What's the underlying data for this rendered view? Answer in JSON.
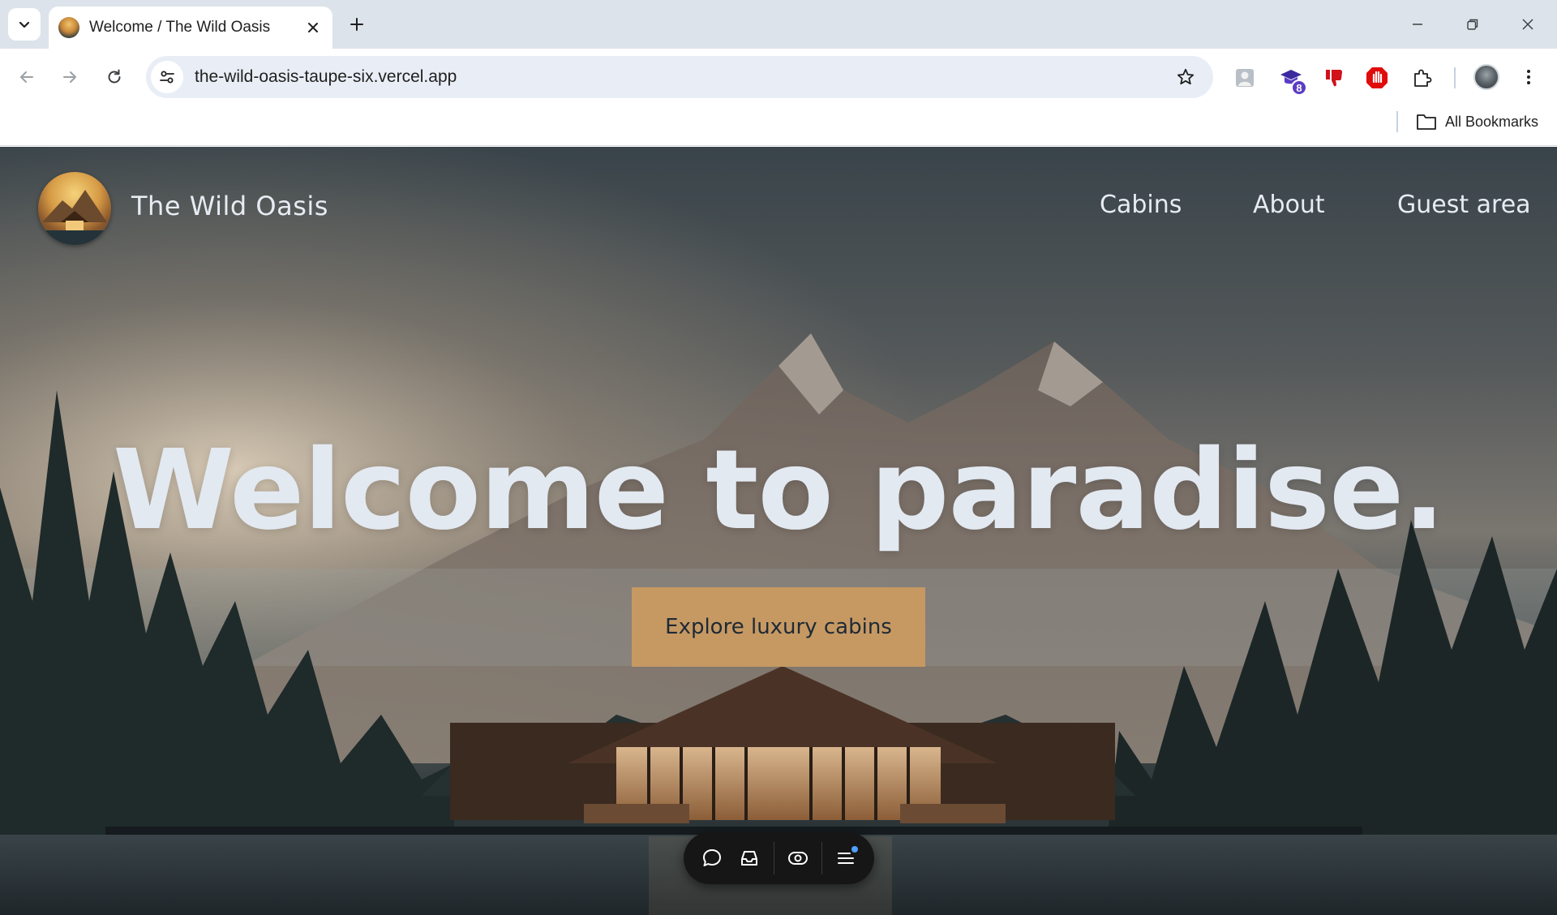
{
  "browser": {
    "tab": {
      "title": "Welcome / The Wild Oasis"
    },
    "url": "the-wild-oasis-taupe-six.vercel.app",
    "extension_badge": "8",
    "bookmarks": {
      "all_label": "All Bookmarks"
    },
    "icons": {
      "tab_search": "chevron-down-icon",
      "tab_close": "close-icon",
      "new_tab": "plus-icon",
      "back": "arrow-left-icon",
      "forward": "arrow-right-icon",
      "reload": "reload-icon",
      "site_info": "tune-icon",
      "bookmark_star": "star-icon",
      "extensions": "puzzle-icon",
      "menu": "kebab-menu-icon",
      "folder": "folder-icon"
    }
  },
  "site": {
    "name": "The Wild Oasis",
    "nav": [
      {
        "label": "Cabins"
      },
      {
        "label": "About"
      },
      {
        "label": "Guest area"
      }
    ],
    "hero": {
      "title": "Welcome to paradise.",
      "cta_label": "Explore luxury cabins"
    },
    "colors": {
      "cta": "#c69963",
      "text": "#e3e9f1",
      "overlay": "#2c363b"
    }
  },
  "dev_toolbar": {
    "icons": [
      "chat-bubble-icon",
      "inbox-icon",
      "eye-icon",
      "menu-icon"
    ]
  }
}
